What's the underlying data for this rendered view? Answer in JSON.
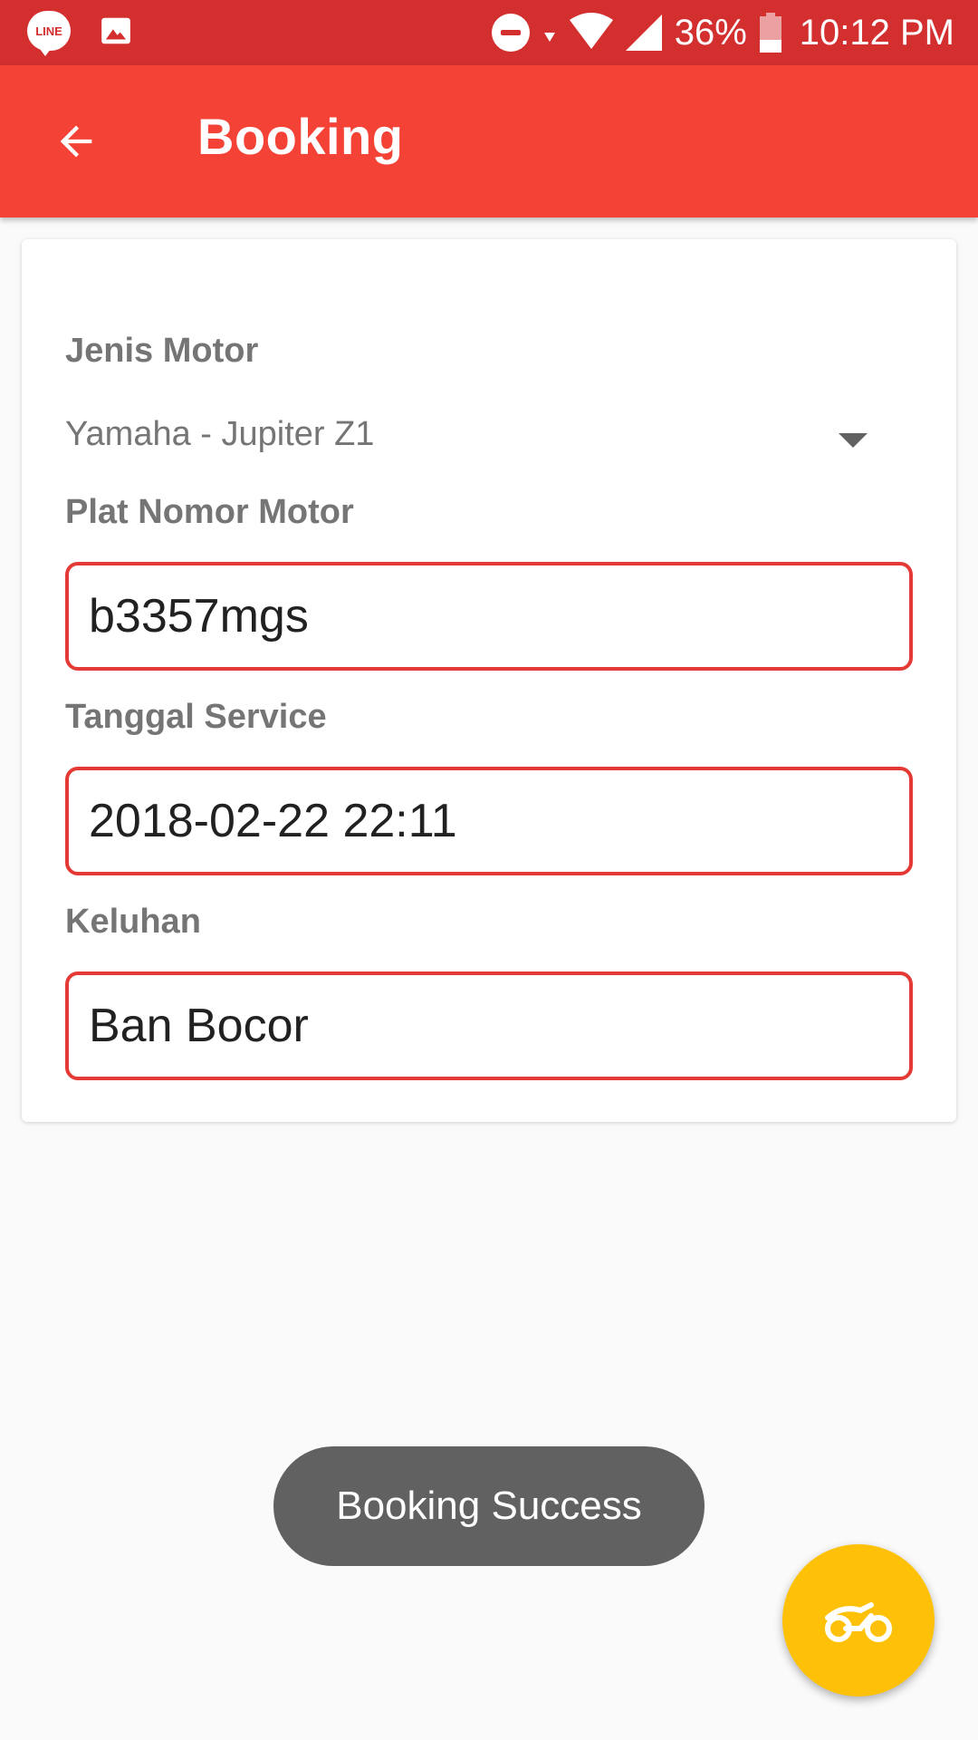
{
  "status_bar": {
    "notification_icons": [
      "line-icon",
      "gallery-icon"
    ],
    "line_label": "LINE",
    "battery_percent": "36%",
    "battery_level": 0.36,
    "time": "10:12 PM",
    "system_icons": [
      "do-not-disturb-icon",
      "wifi-icon",
      "signal-icon",
      "battery-icon"
    ]
  },
  "app_bar": {
    "title": "Booking",
    "back_icon": "arrow-back-icon"
  },
  "form": {
    "jenis_motor": {
      "label": "Jenis Motor",
      "selected": "Yamaha - Jupiter Z1"
    },
    "plat_nomor": {
      "label": "Plat Nomor Motor",
      "value": "b3357mgs"
    },
    "tanggal_service": {
      "label": "Tanggal Service",
      "value": "2018-02-22 22:11"
    },
    "keluhan": {
      "label": "Keluhan",
      "value": "Ban Bocor"
    }
  },
  "toast": {
    "message": "Booking Success"
  },
  "fab": {
    "icon": "motorcycle-icon"
  },
  "colors": {
    "status_bar": "#d32f2f",
    "app_bar": "#f44336",
    "field_border": "#e53935",
    "fab": "#ffc107",
    "toast": "#616161"
  }
}
